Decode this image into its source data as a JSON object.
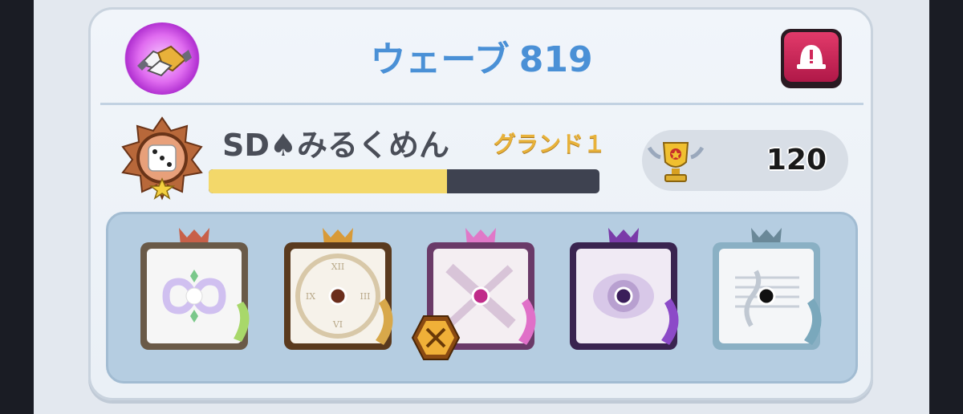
{
  "header": {
    "wave_label": "ウェーブ",
    "wave_number": "819",
    "left_icon": "handshake-icon",
    "right_icon": "report-icon"
  },
  "player": {
    "name": "SD♠みるくめん",
    "rank": "グランド１",
    "badge_icon": "dice-rank-badge-icon",
    "xp_progress": 0.61,
    "trophies": "120",
    "trophy_icon": "trophy-icon"
  },
  "deck": {
    "dice": [
      {
        "name": "infinity-dice",
        "accent": "#a8d86a",
        "pip": "#ffffff"
      },
      {
        "name": "clock-dice",
        "accent": "#d8a84a",
        "pip": "#6b2e1c"
      },
      {
        "name": "syringe-dice",
        "accent": "#e070c8",
        "pip": "#c02c8a"
      },
      {
        "name": "eye-dice",
        "accent": "#8c4ac8",
        "pip": "#3a1e5a"
      },
      {
        "name": "music-dice",
        "accent": "#7aa8bc",
        "pip": "#101010"
      }
    ],
    "class_badge_icon": "swords-hexagon-icon"
  },
  "colors": {
    "wave_text": "#4a90d6",
    "rank_text": "#e8b23a",
    "xp_fill": "#f3d86a",
    "xp_track": "#3e4250",
    "report_button": "#d0285a"
  }
}
